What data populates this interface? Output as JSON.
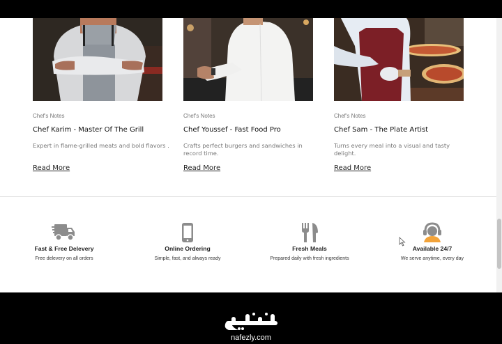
{
  "chef_cards": [
    {
      "category": "Chef's Notes",
      "title": "Chef Karim - Master Of The Grill",
      "description": "Expert in flame-grilled meats and bold flavors .",
      "link_label": "Read More"
    },
    {
      "category": "Chef's Notes",
      "title": "Chef Youssef - Fast Food Pro",
      "description": "Crafts perfect burgers and sandwiches in record time.",
      "link_label": "Read More"
    },
    {
      "category": "Chef's Notes",
      "title": "Chef Sam - The Plate Artist",
      "description": "Turns every meal into a visual and tasty delight.",
      "link_label": "Read More"
    }
  ],
  "features": [
    {
      "icon": "delivery-truck-icon",
      "title": "Fast & Free Delevery",
      "description": "Free delevery on all orders"
    },
    {
      "icon": "phone-icon",
      "title": "Online Ordering",
      "description": "Simple, fast, and always ready"
    },
    {
      "icon": "fork-knife-icon",
      "title": "Fresh Meals",
      "description": "Prepared daily with fresh ingredients"
    },
    {
      "icon": "headset-icon",
      "title": "Available 24/7",
      "description": "We serve anytime, every day"
    }
  ],
  "watermark": {
    "arabic": "نفذلي",
    "latin": "nafezly.com"
  },
  "colors": {
    "page": "#ffffff",
    "frame": "#000000",
    "icon_gray": "#8c8c8c",
    "accent_orange": "#f2a33a"
  }
}
